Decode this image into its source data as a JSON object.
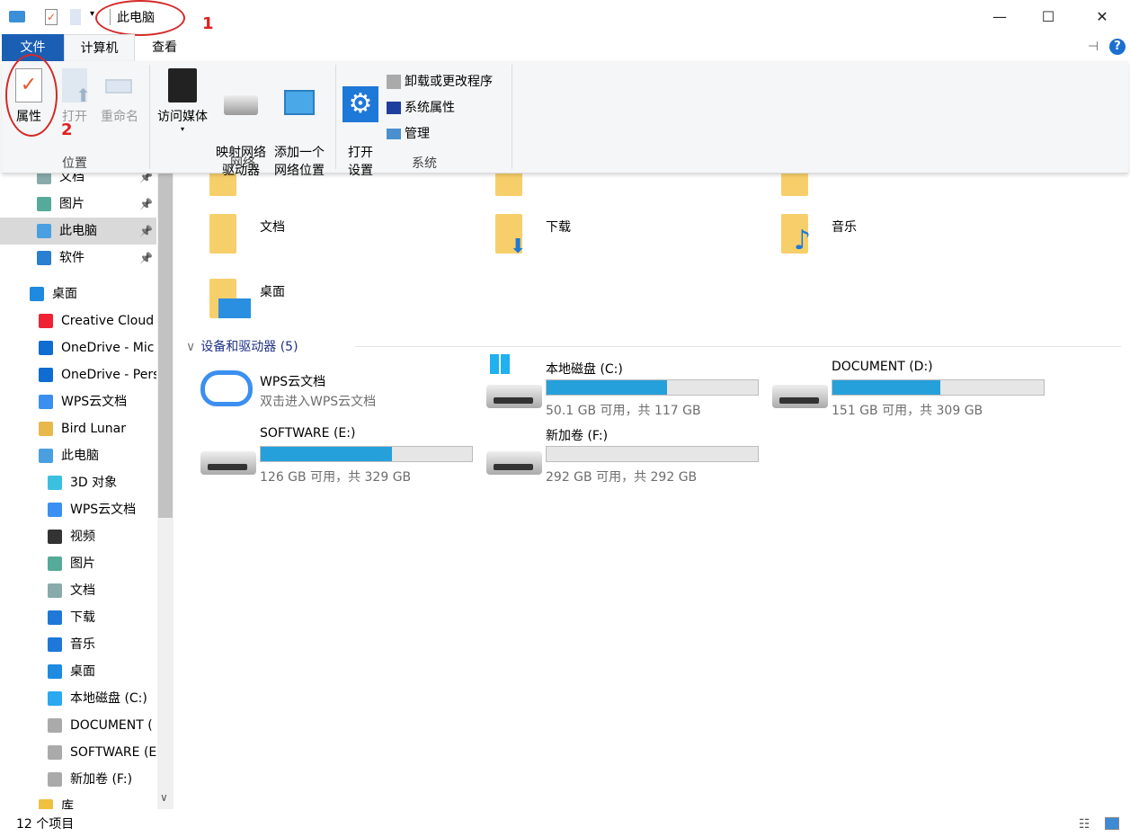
{
  "window": {
    "title": "此电脑",
    "minimize": "—",
    "maximize": "☐",
    "close": "✕",
    "annotation_1": "1",
    "annotation_2": "2"
  },
  "tabs": [
    {
      "label": "文件",
      "active_color": "#1a5fb4"
    },
    {
      "label": "计算机"
    },
    {
      "label": "查看"
    }
  ],
  "ribbon": {
    "groups": [
      {
        "label": "位置",
        "buttons": [
          "属性",
          "打开",
          "重命名"
        ]
      },
      {
        "label": "网络",
        "buttons": [
          "访问媒体",
          "映射网络\n驱动器",
          "添加一个\n网络位置"
        ]
      },
      {
        "label": "系统",
        "buttons": [
          "打开\n设置"
        ],
        "small": [
          "卸载或更改程序",
          "系统属性",
          "管理"
        ]
      }
    ]
  },
  "sidebar": {
    "items": [
      {
        "label": "文档",
        "icon": "document-icon",
        "pinned": true
      },
      {
        "label": "图片",
        "icon": "pictures-icon",
        "pinned": true
      },
      {
        "label": "此电脑",
        "icon": "computer-icon",
        "pinned": true,
        "selected": true
      },
      {
        "label": "软件",
        "icon": "disc-icon",
        "pinned": true
      },
      {
        "label": "桌面",
        "icon": "desktop-icon"
      },
      {
        "label": "Creative Cloud",
        "icon": "creative-cloud-icon"
      },
      {
        "label": "OneDrive - Mic",
        "icon": "onedrive-icon"
      },
      {
        "label": "OneDrive - Pers",
        "icon": "onedrive-icon"
      },
      {
        "label": "WPS云文档",
        "icon": "cloud-icon"
      },
      {
        "label": "Bird Lunar",
        "icon": "user-folder-icon"
      },
      {
        "label": "此电脑",
        "icon": "computer-icon"
      },
      {
        "label": "3D 对象",
        "icon": "3d-icon"
      },
      {
        "label": "WPS云文档",
        "icon": "cloud-icon"
      },
      {
        "label": "视频",
        "icon": "video-icon"
      },
      {
        "label": "图片",
        "icon": "pictures-icon"
      },
      {
        "label": "文档",
        "icon": "document-icon"
      },
      {
        "label": "下载",
        "icon": "download-icon"
      },
      {
        "label": "音乐",
        "icon": "music-icon"
      },
      {
        "label": "桌面",
        "icon": "desktop-icon"
      },
      {
        "label": "本地磁盘 (C:)",
        "icon": "windows-drive-icon"
      },
      {
        "label": "DOCUMENT (",
        "icon": "drive-icon"
      },
      {
        "label": "SOFTWARE (E",
        "icon": "drive-icon"
      },
      {
        "label": "新加卷 (F:)",
        "icon": "drive-icon"
      },
      {
        "label": "库",
        "icon": "library-icon"
      }
    ]
  },
  "folders": [
    "文档",
    "下载",
    "音乐",
    "桌面"
  ],
  "devices": {
    "header": "设备和驱动器 (5)",
    "wps": {
      "name": "WPS云文档",
      "sub": "双击进入WPS云文档"
    },
    "drives": [
      {
        "name": "本地磁盘 (C:)",
        "info": "50.1 GB 可用，共 117 GB",
        "used_fraction": 0.57
      },
      {
        "name": "DOCUMENT (D:)",
        "info": "151 GB 可用，共 309 GB",
        "used_fraction": 0.51
      },
      {
        "name": "SOFTWARE (E:)",
        "info": "126 GB 可用，共 329 GB",
        "used_fraction": 0.62
      },
      {
        "name": "新加卷 (F:)",
        "info": "292 GB 可用，共 292 GB",
        "used_fraction": 0.0
      }
    ],
    "bar_color": "#26a0da"
  },
  "status": {
    "count": "12 个项目"
  }
}
